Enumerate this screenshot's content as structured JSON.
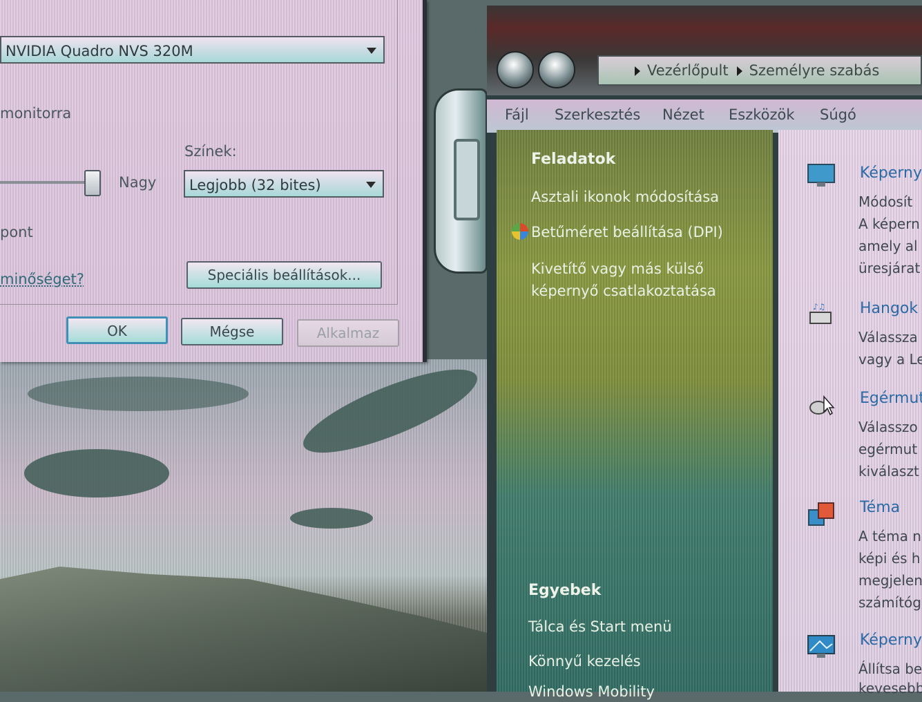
{
  "dialog": {
    "adapter_value": "NVIDIA Quadro NVS 320M",
    "monitor_text": "monitorra",
    "colors_label": "Színek:",
    "colors_value": "Legjobb (32 bites)",
    "size_high_label": "Nagy",
    "pont_text": "pont",
    "quality_link": "minőséget?",
    "advanced_button": "Speciális beállítások...",
    "ok_button": "OK",
    "cancel_button": "Mégse",
    "apply_button": "Alkalmaz"
  },
  "cp": {
    "breadcrumb": [
      "Vezérlőpult",
      "Személyre szabás"
    ],
    "menu": [
      "Fájl",
      "Szerkesztés",
      "Nézet",
      "Eszközök",
      "Súgó"
    ],
    "tasks_header": "Feladatok",
    "tasks": [
      "Asztali ikonok módosítása",
      "Betűméret beállítása (DPI)",
      "Kivetítő vagy más külső",
      "képernyő csatlakoztatása"
    ],
    "other_header": "Egyebek",
    "other_links": [
      "Tálca és Start menü",
      "Könnyű kezelés",
      "Windows Mobility"
    ],
    "categories": [
      {
        "title": "Képerny",
        "desc": [
          "Módosít",
          "A képern",
          "amely al",
          "üresjárat"
        ]
      },
      {
        "title": "Hangok",
        "desc": [
          "Válassza",
          "vagy a Le"
        ]
      },
      {
        "title": "Egérmut",
        "desc": [
          "Válasszo",
          "egérmut",
          "kiválaszt"
        ]
      },
      {
        "title": "Téma",
        "desc": [
          "A téma n",
          "képi és h",
          "megjelen",
          "számítóg"
        ]
      },
      {
        "title": "Képerny",
        "desc": [
          "Állítsa be",
          "kevesebb"
        ]
      }
    ]
  }
}
